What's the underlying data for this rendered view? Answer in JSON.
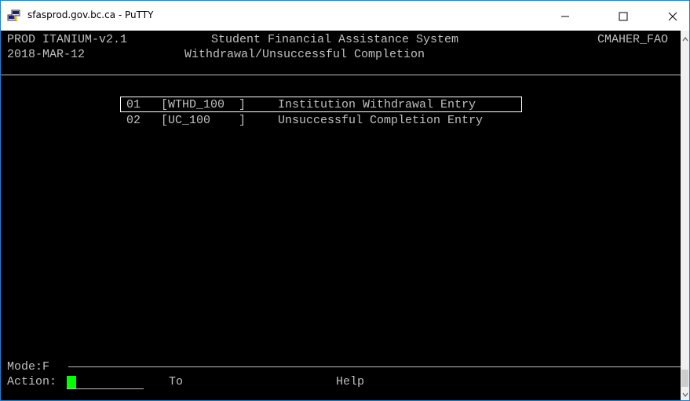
{
  "window": {
    "title": "sfasprod.gov.bc.ca - PuTTY",
    "icon": "putty-icon",
    "controls": [
      "minimize-icon",
      "maximize-icon",
      "close-icon"
    ]
  },
  "terminal": {
    "header": {
      "system_version": "PROD ITANIUM-v2.1",
      "system_name": "Student Financial Assistance System",
      "user": "CMAHER_FAO",
      "date": "2018-MAR-12",
      "screen_title": "Withdrawal/Unsuccessful Completion"
    },
    "menu": [
      {
        "num": "01",
        "code": "[WTHD_100  ]",
        "label": "Institution Withdrawal Entry",
        "selected": true
      },
      {
        "num": "02",
        "code": "[UC_100    ]",
        "label": "Unsuccessful Completion Entry",
        "selected": false
      }
    ],
    "footer": {
      "mode": "Mode:F",
      "action_label": "Action:",
      "to_label": "To",
      "help_label": "Help"
    },
    "colors": {
      "background": "#000000",
      "text": "#c0c0c0",
      "cursor": "#00ff00",
      "selection_border": "#ffffff"
    }
  }
}
